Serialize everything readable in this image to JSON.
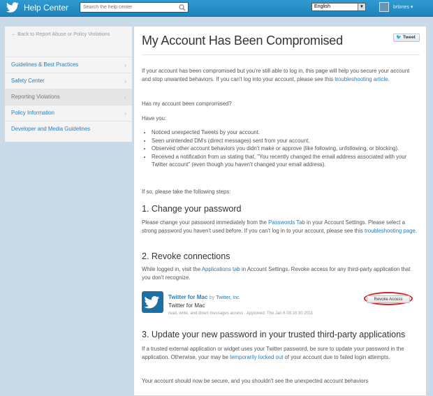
{
  "topbar": {
    "brand": "Help Center",
    "search_placeholder": "Search the help center",
    "language": "English",
    "username": "brtimes"
  },
  "sidebar": {
    "back_link": "← Back to Report Abuse or Policy Violations",
    "items": [
      {
        "label": "Guidelines & Best Practices"
      },
      {
        "label": "Safety Center"
      },
      {
        "label": "Reporting Violations"
      },
      {
        "label": "Policy Information"
      },
      {
        "label": "Developer and Media Guidelines"
      }
    ]
  },
  "main": {
    "tweet_button": "Tweet",
    "title": "My Account Has Been Compromised",
    "intro_text": "If your account has been compromised but you're still able to log in, this page will help you secure your account and stop unwanted behaviors. If you can't log into your account, please see this ",
    "intro_link": "troubleshooting article",
    "intro_end": ".",
    "question": "Has my account been compromised?",
    "have_you": "Have you:",
    "bullets": [
      "Noticed unexpected Tweets by your account.",
      "Seen unintended DM's (direct messages) sent from your account.",
      "Observed other account behaviors you didn't make or approve (like following, unfollowing, or blocking).",
      "Received a notification from us stating that, \"You recently changed the email address associated with your Twitter account\" (even though you haven't changed your email address)."
    ],
    "if_so": "If so, please take the following steps:",
    "step1": {
      "heading": "1. Change your password",
      "text_a": "Please change your password immediately from the ",
      "link_a": "Passwords Tab",
      "text_b": " in your Account Settings. Please select a strong password you haven't used before. If you can't log in to your account, please see this ",
      "link_b": "troubleshooting page",
      "text_c": "."
    },
    "step2": {
      "heading": "2. Revoke connections",
      "text_a": "While logged in, visit the ",
      "link_a": "Applications tab",
      "text_b": " in Account Settings. Revoke access for any third-party application that you don't recognize."
    },
    "app": {
      "name": "Twitter for Mac",
      "by": "by",
      "developer": "Twitter, Inc",
      "subtitle": "Twitter for Mac",
      "permissions": "read, write, and direct messages access · Approved: Thu Jan 6 08:16:30 2011",
      "revoke_label": "Revoke Access"
    },
    "step3": {
      "heading": "3. Update your new password in your trusted third-party applications",
      "text_a": "If a trusted external application or widget uses your Twitter password, be sure to update your password in the application. Otherwise, your may be ",
      "link_a": "temporarily locked out",
      "text_b": " of your account due to failed login attempts."
    },
    "closing": "Your account should now be secure, and you shouldn't see the unexpected account behaviors"
  },
  "colors": {
    "topbar": "#2390c8",
    "link": "#2b7bb9",
    "highlight_ring": "#d5232a"
  }
}
